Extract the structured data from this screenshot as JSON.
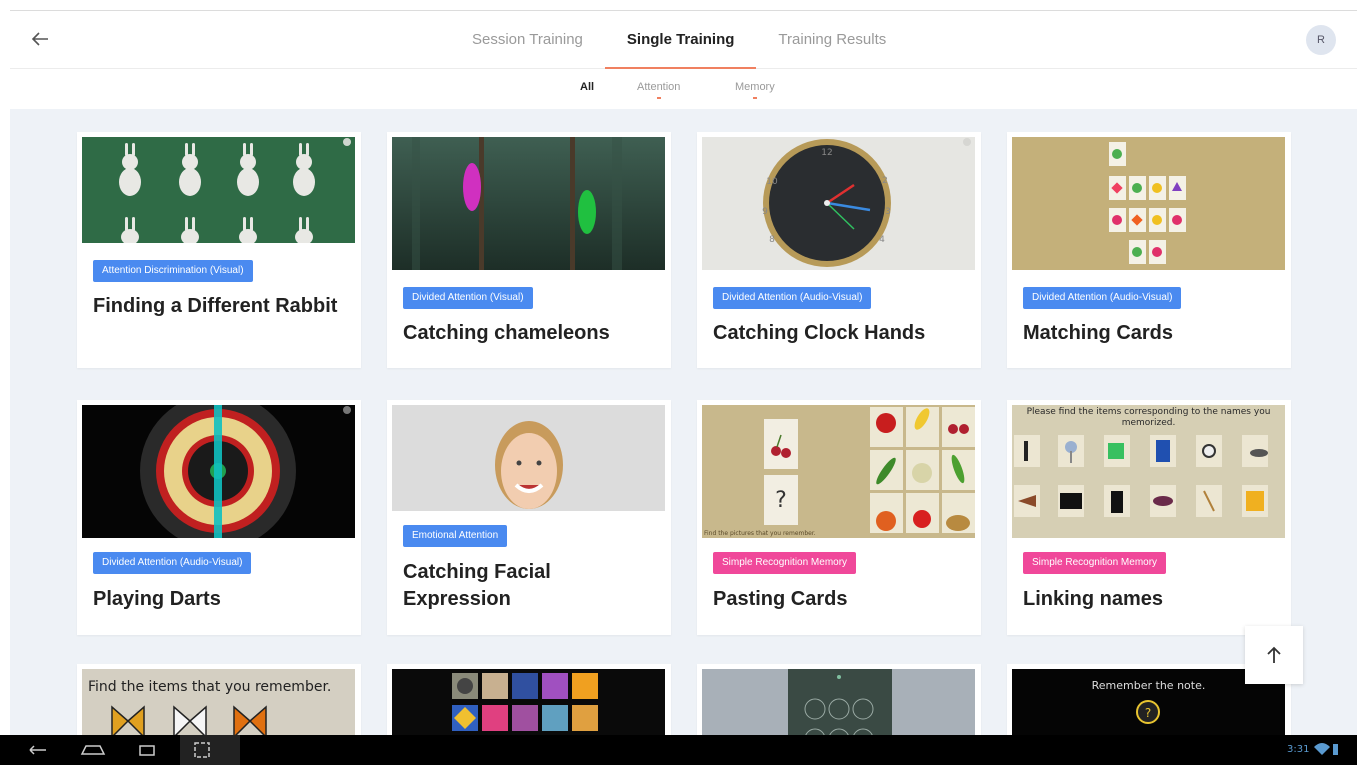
{
  "header": {
    "tabs": [
      {
        "label": "Session Training"
      },
      {
        "label": "Single Training"
      },
      {
        "label": "Training Results"
      }
    ],
    "avatar_initial": "R"
  },
  "filters": [
    {
      "label": "All"
    },
    {
      "label": "Attention"
    },
    {
      "label": "Memory"
    }
  ],
  "cards": [
    {
      "tag": "Attention Discrimination (Visual)",
      "title": "Finding a Different Rabbit"
    },
    {
      "tag": "Divided Attention (Visual)",
      "title": "Catching chameleons"
    },
    {
      "tag": "Divided Attention (Audio-Visual)",
      "title": "Catching Clock Hands"
    },
    {
      "tag": "Divided Attention (Audio-Visual)",
      "title": "Matching Cards"
    },
    {
      "tag": "Divided Attention (Audio-Visual)",
      "title": "Playing Darts"
    },
    {
      "tag": "Emotional Attention",
      "title": "Catching Facial Expression"
    },
    {
      "tag": "Simple Recognition Memory",
      "title": "Pasting Cards"
    },
    {
      "tag": "Simple Recognition Memory",
      "title": "Linking names"
    }
  ],
  "thumb_text": {
    "linking": "Please find the items corresponding to the names you memorized.",
    "pasting": "Find the pictures that you remember.",
    "bottom_items": "Find the items that you remember.",
    "bottom_note": "Remember the note."
  },
  "status": {
    "time": "3:31"
  },
  "colors": {
    "accent": "#f08060",
    "tag_blue": "#4a8af0",
    "tag_pink": "#f0489a"
  }
}
